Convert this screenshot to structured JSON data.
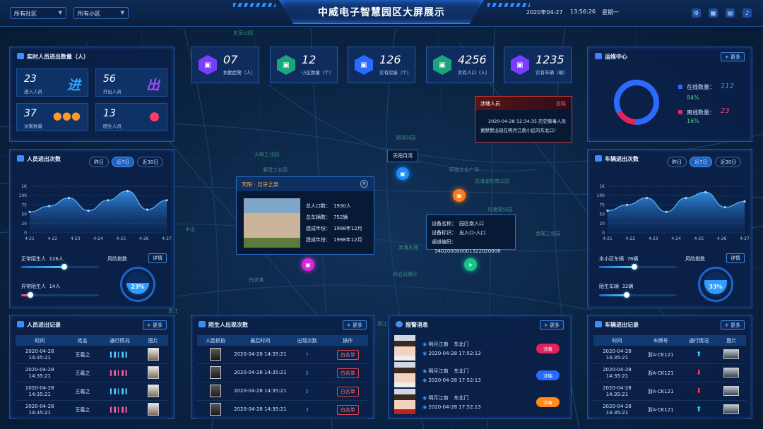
{
  "header": {
    "community_select": "所有社区",
    "area_select": "所有小区",
    "title": "中威电子智慧园区大屏展示",
    "date": "2020年04-27",
    "time": "13:56:26",
    "weekday": "星期一"
  },
  "map": {
    "labels": [
      "东茂公园",
      "紫金港",
      "半山",
      "天和工业园",
      "湖滨公园",
      "明珠文化广场",
      "瓜渚湖公园",
      "瓜渚湖东岸公园",
      "金属工业园",
      "夏建工业园",
      "赤滩东苑",
      "半平山",
      "白米滩",
      "柯岩风景区",
      "南湖公园",
      "万达东岸公园",
      "浙江",
      "浙江",
      "浙江",
      "园区公园",
      "万达广场"
    ],
    "pin_label": "天阳月湾",
    "community_popup": {
      "title": "天阳 · 月牙之泉",
      "rows": [
        [
          "总人口数：",
          "1930人"
        ],
        [
          "总车辆数：",
          "752辆"
        ],
        [
          "建成年份：",
          "1998年12月"
        ],
        [
          "建成年份：",
          "1998年12月"
        ]
      ]
    },
    "device_popup": {
      "rows": [
        [
          "设备名称：",
          "园区南入口"
        ],
        [
          "设备标识：",
          "出入口-入口"
        ],
        [
          "通道编码：",
          "340200000001322020006"
        ]
      ]
    },
    "alert_popup": {
      "title": "涉赌人员",
      "ignore": "忽略",
      "time": "2020-04-28 12:34:35",
      "text1": "历史贩毒人员",
      "text2": "黄默默出现在明月江南小区的东北口！"
    }
  },
  "kpis": [
    {
      "value": "07",
      "label": "执勤民警（人）",
      "color": "#7a3cff",
      "icon": "police-icon"
    },
    {
      "value": "12",
      "label": "小区数量（个）",
      "color": "#1aa57a",
      "icon": "building-icon"
    },
    {
      "value": "126",
      "label": "实有房屋（个）",
      "color": "#2a6bff",
      "icon": "house-icon"
    },
    {
      "value": "4256",
      "label": "实有人口（人）",
      "color": "#1aa57a",
      "icon": "person-icon"
    },
    {
      "value": "1235",
      "label": "实有车辆（辆）",
      "color": "#7a3cff",
      "icon": "car-icon"
    }
  ],
  "realtime": {
    "title": "实时人员进出数量（人）",
    "tiles": [
      {
        "value": "23",
        "label": "进入人员",
        "big": "进",
        "color": "#2fa0ff"
      },
      {
        "value": "56",
        "label": "外出人员",
        "big": "出",
        "color": "#a04dff"
      },
      {
        "value": "37",
        "label": "访客数量",
        "big": "👥",
        "color": "#ff9a2a"
      },
      {
        "value": "13",
        "label": "陌生人员",
        "big": "👤",
        "color": "#ff3a6a"
      }
    ]
  },
  "ops": {
    "title": "运维中心",
    "more": "+ 更多",
    "online_label": "在线数量：",
    "online_value": "112",
    "online_pct": "84%",
    "offline_label": "离线数量：",
    "offline_value": "23",
    "offline_pct": "16%",
    "online_color": "#2a6bff",
    "offline_color": "#e0245e"
  },
  "person_flow": {
    "title": "人员进出次数",
    "tabs": [
      "昨日",
      "近7日",
      "近30日"
    ],
    "normal_label": "正常陌生人",
    "normal_value": "126人",
    "normal_pct": 0.55,
    "abnormal_label": "异常陌生人",
    "abnormal_value": "14人",
    "abnormal_pct": 0.12,
    "risk_label": "风险指数",
    "detail": "详情",
    "gauge": "23%"
  },
  "vehicle_flow": {
    "title": "车辆进出次数",
    "tabs": [
      "昨日",
      "近7日",
      "近30日"
    ],
    "normal_label": "本小区车辆",
    "normal_value": "76辆",
    "normal_pct": 0.45,
    "abnormal_label": "陌生车辆",
    "abnormal_value": "32辆",
    "abnormal_pct": 0.35,
    "risk_label": "风险指数",
    "detail": "详情",
    "gauge": "33%"
  },
  "chart_data": [
    {
      "type": "area",
      "x": [
        "4-21",
        "4-22",
        "4-23",
        "4-24",
        "4-25",
        "4-26",
        "4-27"
      ],
      "series": [
        {
          "values": [
            90,
            115,
            150,
            95,
            140,
            180,
            100,
            140
          ]
        }
      ],
      "yticks": [
        "0",
        "20",
        "50",
        "75",
        "100",
        "1K"
      ],
      "ylim": [
        0,
        1000
      ]
    },
    {
      "type": "area",
      "x": [
        "4-21",
        "4-22",
        "4-23",
        "4-24",
        "4-25",
        "4-26",
        "4-27"
      ],
      "series": [
        {
          "values": [
            95,
            120,
            150,
            90,
            150,
            175,
            110,
            135
          ]
        }
      ],
      "yticks": [
        "0",
        "20",
        "50",
        "75",
        "100",
        "1K"
      ],
      "ylim": [
        0,
        1000
      ]
    }
  ],
  "person_records": {
    "title": "人员进出记录",
    "more": "+ 更多",
    "headers": [
      "时间",
      "姓名",
      "通行情况",
      "图片"
    ],
    "rows": [
      [
        "2020-04-28 14:35:21",
        "王羲之"
      ],
      [
        "2020-04-28 14:35:21",
        "王羲之"
      ],
      [
        "2020-04-28 14:35:21",
        "王羲之"
      ],
      [
        "2020-04-28 14:35:21",
        "王羲之"
      ]
    ]
  },
  "stranger": {
    "title": "陌生人出现次数",
    "more": "+ 更多",
    "headers": [
      "人脸抓拍",
      "最后时间",
      "出现次数",
      "操作"
    ],
    "rows": [
      [
        "2020-04-28 14:35:21",
        "7",
        "白名单"
      ],
      [
        "2020-04-28 14:35:21",
        "5",
        "白名单"
      ],
      [
        "2020-04-28 14:35:21",
        "5",
        "白名单"
      ],
      [
        "2020-04-28 14:35:21",
        "3",
        "白名单"
      ]
    ]
  },
  "alarms": {
    "title": "报警消息",
    "more": "+ 更多",
    "rows": [
      {
        "place": "明月江南",
        "gate": "东北门",
        "time": "2020-04-28  17:52:13",
        "tag": "涉黄",
        "color": "#e0245e"
      },
      {
        "place": "明月江南",
        "gate": "东北门",
        "time": "2020-04-28  17:52:13",
        "tag": "涉赌",
        "color": "#2a6bff"
      },
      {
        "place": "明月江南",
        "gate": "东北门",
        "time": "2020-04-28  17:52:13",
        "tag": "涉毒",
        "color": "#ff8a1a"
      }
    ]
  },
  "vehicle_records": {
    "title": "车辆进出记录",
    "more": "+ 更多",
    "headers": [
      "时间",
      "车牌号",
      "通行情况",
      "图片"
    ],
    "rows": [
      [
        "2020-04-28 14:35:21",
        "浙A·CK121",
        "in"
      ],
      [
        "2020-04-28 14:35:21",
        "浙A·CK121",
        "out"
      ],
      [
        "2020-04-28 14:35:21",
        "浙A·CK121",
        "out"
      ],
      [
        "2020-04-28 14:35:21",
        "浙A·CK121",
        "in"
      ]
    ]
  }
}
